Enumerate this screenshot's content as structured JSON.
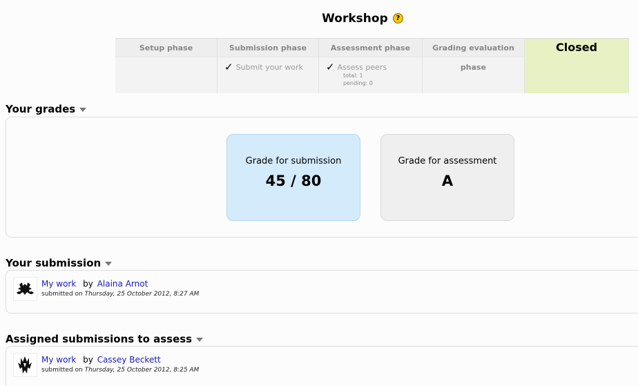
{
  "page": {
    "title": "Workshop",
    "help_icon": "help-icon"
  },
  "phases": [
    {
      "title": "Setup phase"
    },
    {
      "title": "Submission phase",
      "task": "Submit your work"
    },
    {
      "title": "Assessment phase",
      "task": "Assess peers",
      "details": [
        "total: 1",
        "pending: 0"
      ]
    },
    {
      "title": "Grading evaluation phase"
    },
    {
      "title": "Closed"
    }
  ],
  "grades": {
    "heading": "Your grades",
    "submission": {
      "label": "Grade for submission",
      "value": "45 / 80"
    },
    "assessment": {
      "label": "Grade for assessment",
      "value": "A"
    }
  },
  "your_submission": {
    "heading": "Your submission",
    "title_link": "My work",
    "by": "by",
    "author": "Alaina Arnot",
    "submitted_prefix": "submitted on",
    "submitted_date": "Thursday, 25 October 2012, 8:27 AM"
  },
  "assigned": {
    "heading": "Assigned submissions to assess",
    "title_link": "My work",
    "by": "by",
    "author": "Cassey Beckett",
    "submitted_prefix": "submitted on",
    "submitted_date": "Thursday, 25 October 2012, 8:25 AM"
  },
  "colors": {
    "link": "#1a1ab8",
    "active_phase": "#e7f1c3",
    "submission_grade_bg": "#d4ebfc",
    "assessment_grade_bg": "#efefef"
  }
}
